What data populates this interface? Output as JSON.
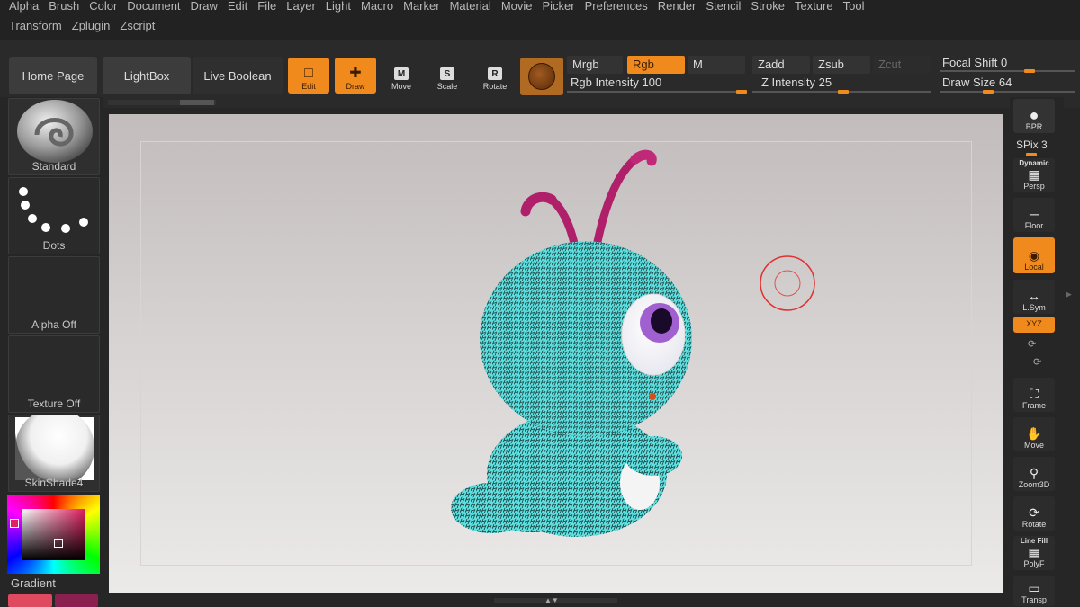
{
  "menu": {
    "row1": [
      "Alpha",
      "Brush",
      "Color",
      "Document",
      "Draw",
      "Edit",
      "File",
      "Layer",
      "Light",
      "Macro",
      "Marker",
      "Material",
      "Movie",
      "Picker",
      "Preferences",
      "Render",
      "Stencil",
      "Stroke",
      "Texture",
      "Tool"
    ],
    "row2": [
      "Transform",
      "Zplugin",
      "Zscript"
    ]
  },
  "toolbar": {
    "home_page": "Home Page",
    "lightbox": "LightBox",
    "live_boolean": "Live Boolean",
    "edit": "Edit",
    "draw": "Draw",
    "move": "Move",
    "move_key": "M",
    "scale": "Scale",
    "scale_key": "S",
    "rotate": "Rotate",
    "rotate_key": "R",
    "mrgb": "Mrgb",
    "rgb": "Rgb",
    "m": "M",
    "rgb_intensity_label": "Rgb Intensity",
    "rgb_intensity": "100",
    "zadd": "Zadd",
    "zsub": "Zsub",
    "zcut": "Zcut",
    "z_intensity_label": "Z Intensity",
    "z_intensity": "25",
    "focal_shift_label": "Focal Shift",
    "focal_shift": "0",
    "draw_size_label": "Draw Size",
    "draw_size": "64"
  },
  "left_panel": {
    "brush": "Standard",
    "stroke": "Dots",
    "alpha": "Alpha Off",
    "texture": "Texture Off",
    "material": "SkinShade4",
    "gradient": "Gradient"
  },
  "right_panel": {
    "bpr": "BPR",
    "spix_label": "SPix",
    "spix": "3",
    "dynamic": "Dynamic",
    "persp": "Persp",
    "floor": "Floor",
    "local": "Local",
    "lsym": "L.Sym",
    "xyz": "XYZ",
    "frame": "Frame",
    "move": "Move",
    "zoom3d": "Zoom3D",
    "rotate": "Rotate",
    "line_fill": "Line Fill",
    "polyf": "PolyF",
    "transp": "Transp"
  },
  "colors": {
    "accent": "#f08a1c",
    "model": "#5ee0e0",
    "antenna": "#b0206a"
  }
}
